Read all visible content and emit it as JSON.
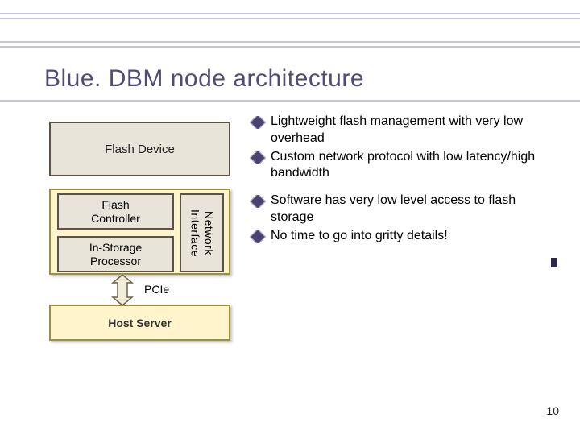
{
  "title": "Blue. DBM node architecture",
  "diagram": {
    "flash_device": "Flash Device",
    "flash_controller": "Flash\nController",
    "instorage": "In-Storage\nProcessor",
    "network_interface": "Network\nInterface",
    "pcie": "PCIe",
    "host_server": "Host Server"
  },
  "bullets_top": [
    "Lightweight flash management with very low overhead",
    "Custom network protocol with low latency/high bandwidth"
  ],
  "bullets_mid": [
    "Software has very low level access to flash storage",
    "No time to go into gritty details!"
  ],
  "page_number": "10"
}
